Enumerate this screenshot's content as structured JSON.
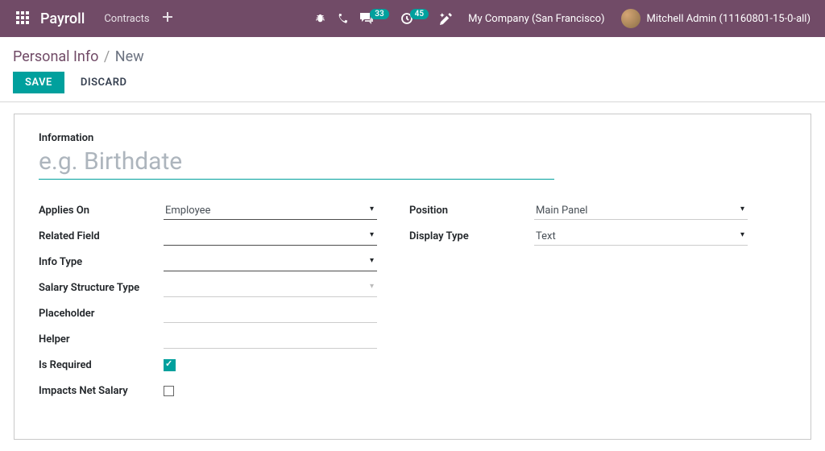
{
  "navbar": {
    "brand": "Payroll",
    "menu": {
      "contracts": "Contracts"
    },
    "badges": {
      "messages": "33",
      "activities": "45"
    },
    "company": "My Company (San Francisco)",
    "user": "Mitchell Admin (11160801-15-0-all)"
  },
  "breadcrumb": {
    "parent": "Personal Info",
    "current": "New"
  },
  "buttons": {
    "save": "SAVE",
    "discard": "DISCARD"
  },
  "form": {
    "title_label": "Information",
    "title_placeholder": "e.g. Birthdate",
    "title_value": "",
    "left": {
      "applies_on": {
        "label": "Applies On",
        "value": "Employee"
      },
      "related_field": {
        "label": "Related Field",
        "value": ""
      },
      "info_type": {
        "label": "Info Type",
        "value": ""
      },
      "salary_structure_type": {
        "label": "Salary Structure Type",
        "value": ""
      },
      "placeholder_f": {
        "label": "Placeholder",
        "value": ""
      },
      "helper": {
        "label": "Helper",
        "value": ""
      },
      "is_required": {
        "label": "Is Required",
        "checked": true
      },
      "impacts_net": {
        "label": "Impacts Net Salary",
        "checked": false
      }
    },
    "right": {
      "position": {
        "label": "Position",
        "value": "Main Panel"
      },
      "display_type": {
        "label": "Display Type",
        "value": "Text"
      }
    }
  }
}
